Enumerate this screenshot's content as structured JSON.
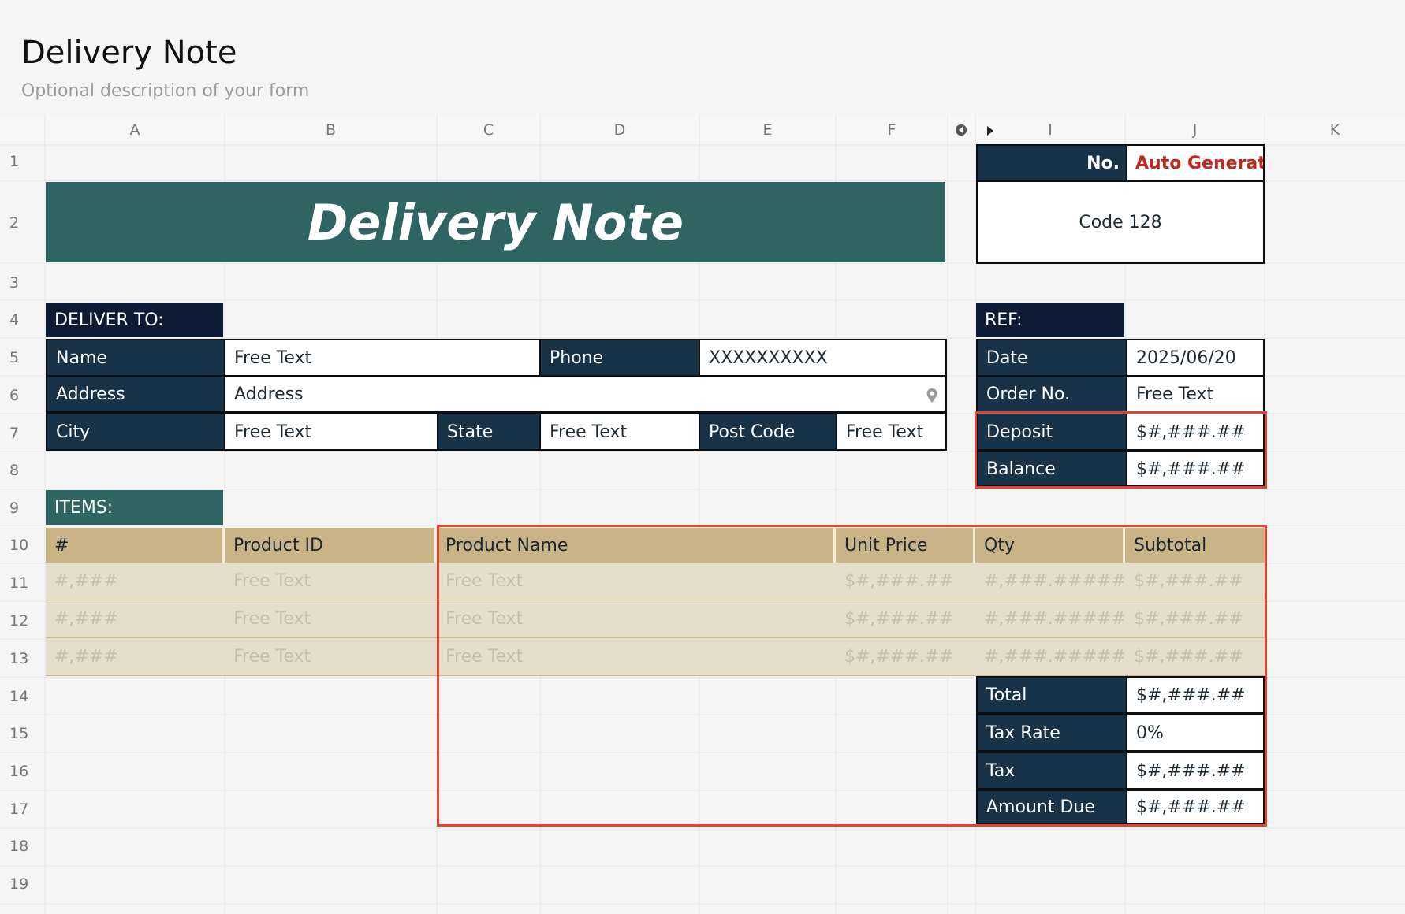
{
  "form": {
    "title": "Delivery Note",
    "description": "Optional description of your form"
  },
  "columns": [
    "A",
    "B",
    "C",
    "D",
    "E",
    "F",
    "I",
    "J",
    "K"
  ],
  "rows": [
    "1",
    "2",
    "3",
    "4",
    "5",
    "6",
    "7",
    "8",
    "9",
    "10",
    "11",
    "12",
    "13",
    "14",
    "15",
    "16",
    "17",
    "18",
    "19"
  ],
  "banner": "Delivery Note",
  "doc_no": {
    "label": "No.",
    "value": "Auto Generate",
    "barcode": "Code 128"
  },
  "deliver_to": {
    "heading": "DELIVER TO:",
    "name_label": "Name",
    "name_value": "Free Text",
    "phone_label": "Phone",
    "phone_value": "XXXXXXXXXX",
    "address_label": "Address",
    "address_value": "Address",
    "city_label": "City",
    "city_value": "Free Text",
    "state_label": "State",
    "state_value": "Free Text",
    "postcode_label": "Post Code",
    "postcode_value": "Free Text"
  },
  "ref": {
    "heading": "REF:",
    "date_label": "Date",
    "date_value": "2025/06/20",
    "order_label": "Order No.",
    "order_value": "Free Text",
    "deposit_label": "Deposit",
    "deposit_value": "$#,###.##",
    "balance_label": "Balance",
    "balance_value": "$#,###.##"
  },
  "items": {
    "heading": "ITEMS:",
    "headers": [
      "#",
      "Product ID",
      "Product Name",
      "Unit Price",
      "Qty",
      "Subtotal"
    ],
    "rows": [
      [
        "#,###",
        "Free Text",
        "Free Text",
        "$#,###.##",
        "#,###.#####",
        "$#,###.##"
      ],
      [
        "#,###",
        "Free Text",
        "Free Text",
        "$#,###.##",
        "#,###.#####",
        "$#,###.##"
      ],
      [
        "#,###",
        "Free Text",
        "Free Text",
        "$#,###.##",
        "#,###.#####",
        "$#,###.##"
      ]
    ]
  },
  "totals": {
    "total_label": "Total",
    "total_value": "$#,###.##",
    "taxrate_label": "Tax Rate",
    "taxrate_value": "0%",
    "tax_label": "Tax",
    "tax_value": "$#,###.##",
    "due_label": "Amount Due",
    "due_value": "$#,###.##"
  },
  "colors": {
    "navy": "#183247",
    "teal": "#2e6462",
    "tan": "#c9b487",
    "highlight": "#e14530",
    "auto_generate": "#c0281e"
  }
}
